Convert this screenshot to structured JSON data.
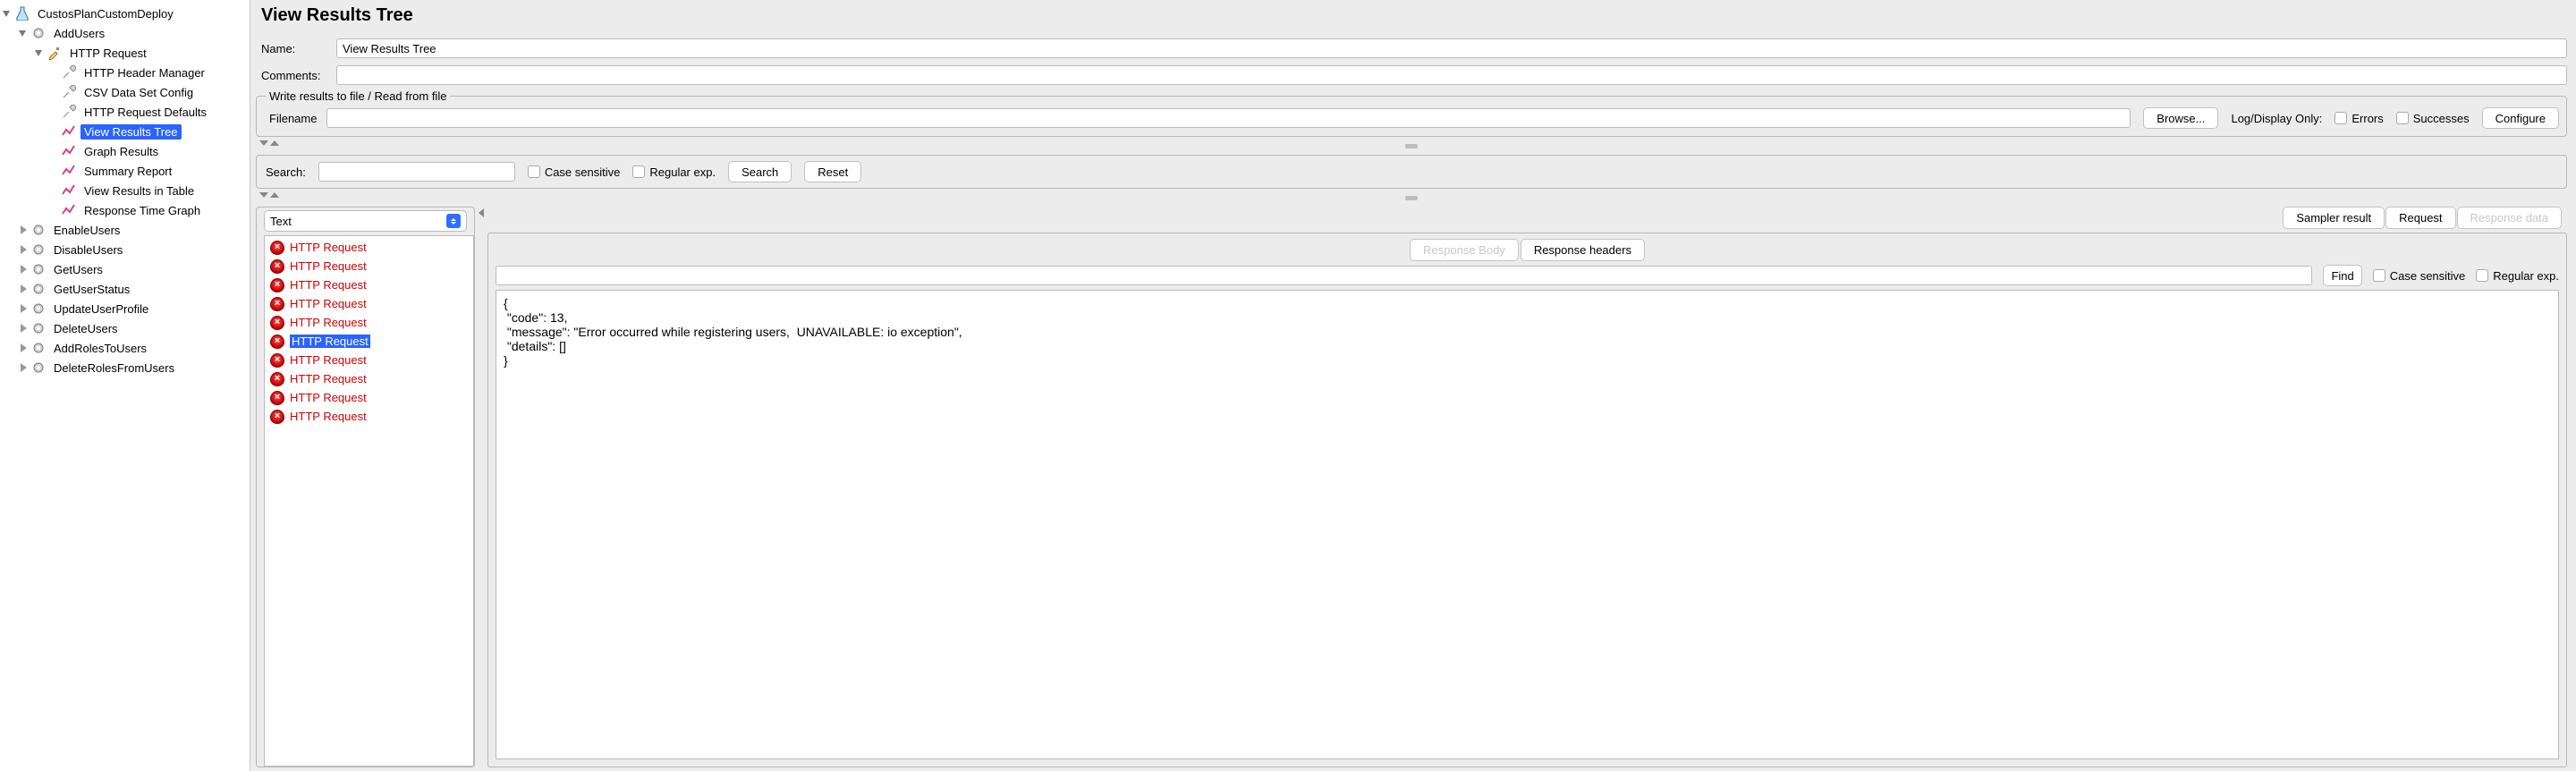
{
  "tree": {
    "root": "CustosPlanCustomDeploy",
    "group": "AddUsers",
    "sampler": "HTTP Request",
    "children": [
      "HTTP Header Manager",
      "CSV Data Set Config",
      "HTTP Request Defaults",
      "View Results Tree",
      "Graph Results",
      "Summary Report",
      "View Results in Table",
      "Response Time Graph"
    ],
    "siblings": [
      "EnableUsers",
      "DisableUsers",
      "GetUsers",
      "GetUserStatus",
      "UpdateUserProfile",
      "DeleteUsers",
      "AddRolesToUsers",
      "DeleteRolesFromUsers"
    ]
  },
  "header": {
    "title": "View Results Tree"
  },
  "form": {
    "name_label": "Name:",
    "name_value": "View Results Tree",
    "comments_label": "Comments:",
    "comments_value": ""
  },
  "filebox": {
    "legend": "Write results to file / Read from file",
    "filename_label": "Filename",
    "filename_value": "",
    "browse": "Browse...",
    "logonly": "Log/Display Only:",
    "errors": "Errors",
    "successes": "Successes",
    "configure": "Configure"
  },
  "search": {
    "label": "Search:",
    "value": "",
    "case": "Case sensitive",
    "regex": "Regular exp.",
    "search_btn": "Search",
    "reset_btn": "Reset"
  },
  "renderer": {
    "value": "Text"
  },
  "results": {
    "items": [
      "HTTP Request",
      "HTTP Request",
      "HTTP Request",
      "HTTP Request",
      "HTTP Request",
      "HTTP Request",
      "HTTP Request",
      "HTTP Request",
      "HTTP Request",
      "HTTP Request"
    ],
    "selected": 5
  },
  "tabs": {
    "sampler": "Sampler result",
    "request": "Request",
    "response": "Response data",
    "body": "Response Body",
    "headers": "Response headers"
  },
  "find": {
    "value": "",
    "btn": "Find",
    "case": "Case sensitive",
    "regex": "Regular exp."
  },
  "response_body": "{\n \"code\": 13,\n \"message\": \"Error occurred while registering users,  UNAVAILABLE: io exception\",\n \"details\": []\n}"
}
